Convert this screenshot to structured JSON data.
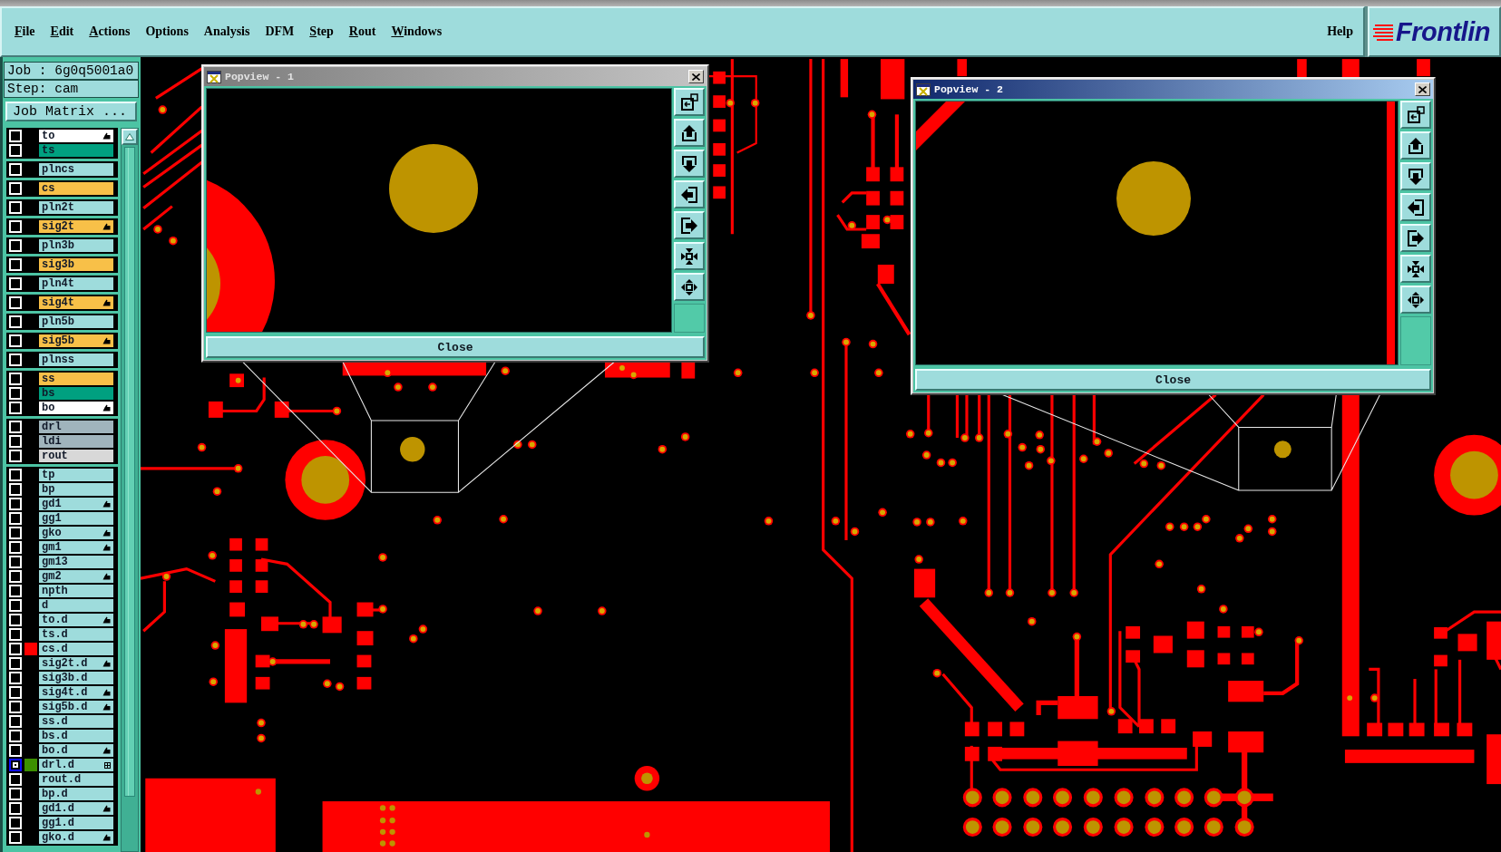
{
  "menu_bar": {
    "items": [
      {
        "label": "File",
        "mnemonic": true
      },
      {
        "label": "Edit",
        "mnemonic": true
      },
      {
        "label": "Actions",
        "mnemonic": true
      },
      {
        "label": "Options",
        "mnemonic": false
      },
      {
        "label": "Analysis",
        "mnemonic": false
      },
      {
        "label": "DFM",
        "mnemonic": false
      },
      {
        "label": "Step",
        "mnemonic": true
      },
      {
        "label": "Rout",
        "mnemonic": true
      },
      {
        "label": "Windows",
        "mnemonic": true
      }
    ],
    "help": "Help"
  },
  "logo": "Frontlin",
  "job_panel": {
    "job": "Job : 6g0q5001a0",
    "step": "Step: cam",
    "matrix_button": "Job Matrix ..."
  },
  "layer_groups": [
    {
      "layers": [
        {
          "name": "to",
          "color": "#ffffff",
          "kind": "pointer",
          "work_layer": false
        },
        {
          "name": "ts",
          "color": "#00a080",
          "kind": "plain",
          "work_layer": false
        }
      ]
    },
    {
      "layers": [
        {
          "name": "plncs",
          "color": "#9edcdc",
          "kind": "plain",
          "work_layer": false
        }
      ]
    },
    {
      "layers": [
        {
          "name": "cs",
          "color": "#f8c048",
          "kind": "plain",
          "work_layer": false
        }
      ]
    },
    {
      "layers": [
        {
          "name": "pln2t",
          "color": "#9edcdc",
          "kind": "plain",
          "work_layer": false
        }
      ]
    },
    {
      "layers": [
        {
          "name": "sig2t",
          "color": "#f8c048",
          "kind": "pointer",
          "work_layer": false
        }
      ]
    },
    {
      "layers": [
        {
          "name": "pln3b",
          "color": "#9edcdc",
          "kind": "plain",
          "work_layer": false
        }
      ]
    },
    {
      "layers": [
        {
          "name": "sig3b",
          "color": "#f8c048",
          "kind": "plain",
          "work_layer": false
        }
      ]
    },
    {
      "layers": [
        {
          "name": "pln4t",
          "color": "#9edcdc",
          "kind": "plain",
          "work_layer": false
        }
      ]
    },
    {
      "layers": [
        {
          "name": "sig4t",
          "color": "#f8c048",
          "kind": "pointer",
          "work_layer": false
        }
      ]
    },
    {
      "layers": [
        {
          "name": "pln5b",
          "color": "#9edcdc",
          "kind": "plain",
          "work_layer": false
        }
      ]
    },
    {
      "layers": [
        {
          "name": "sig5b",
          "color": "#f8c048",
          "kind": "pointer",
          "work_layer": false
        }
      ]
    },
    {
      "layers": [
        {
          "name": "plnss",
          "color": "#9edcdc",
          "kind": "plain",
          "work_layer": false
        }
      ]
    },
    {
      "layers": [
        {
          "name": "ss",
          "color": "#f8c048",
          "kind": "plain",
          "work_layer": false
        },
        {
          "name": "bs",
          "color": "#00a080",
          "kind": "plain",
          "work_layer": false
        },
        {
          "name": "bo",
          "color": "#ffffff",
          "kind": "pointer",
          "work_layer": false
        }
      ]
    },
    {
      "layers": [
        {
          "name": "drl",
          "color": "#a0b4bc",
          "kind": "plain",
          "work_layer": false
        },
        {
          "name": "ldi",
          "color": "#a0b4bc",
          "kind": "plain",
          "work_layer": false
        },
        {
          "name": "rout",
          "color": "#d8d8d8",
          "kind": "plain",
          "work_layer": false
        }
      ]
    },
    {
      "layers": [
        {
          "name": "tp",
          "color": "#9edcdc",
          "kind": "plain",
          "work_layer": false
        },
        {
          "name": "bp",
          "color": "#9edcdc",
          "kind": "plain",
          "work_layer": false
        },
        {
          "name": "gd1",
          "color": "#9edcdc",
          "kind": "pointer",
          "work_layer": false
        },
        {
          "name": "gg1",
          "color": "#9edcdc",
          "kind": "plain",
          "work_layer": false
        },
        {
          "name": "gko",
          "color": "#9edcdc",
          "kind": "pointer",
          "work_layer": false
        },
        {
          "name": "gm1",
          "color": "#9edcdc",
          "kind": "pointer",
          "work_layer": false
        },
        {
          "name": "gm13",
          "color": "#9edcdc",
          "kind": "plain",
          "work_layer": false
        },
        {
          "name": "gm2",
          "color": "#9edcdc",
          "kind": "pointer",
          "work_layer": false
        },
        {
          "name": "npth",
          "color": "#9edcdc",
          "kind": "plain",
          "work_layer": false
        },
        {
          "name": "d",
          "color": "#9edcdc",
          "kind": "plain",
          "work_layer": false
        },
        {
          "name": "to.d",
          "color": "#9edcdc",
          "kind": "pointer",
          "work_layer": false
        },
        {
          "name": "ts.d",
          "color": "#9edcdc",
          "kind": "plain",
          "work_layer": false
        },
        {
          "name": "cs.d",
          "color": "#9edcdc",
          "swatch": {
            "color": "#ff0000"
          },
          "kind": "plain",
          "work_layer": false
        },
        {
          "name": "sig2t.d",
          "color": "#9edcdc",
          "kind": "pointer",
          "work_layer": false
        },
        {
          "name": "sig3b.d",
          "color": "#9edcdc",
          "kind": "plain",
          "work_layer": false
        },
        {
          "name": "sig4t.d",
          "color": "#9edcdc",
          "kind": "pointer",
          "work_layer": false
        },
        {
          "name": "sig5b.d",
          "color": "#9edcdc",
          "kind": "pointer",
          "work_layer": false
        },
        {
          "name": "ss.d",
          "color": "#9edcdc",
          "kind": "plain",
          "work_layer": false
        },
        {
          "name": "bs.d",
          "color": "#9edcdc",
          "kind": "plain",
          "work_layer": false
        },
        {
          "name": "bo.d",
          "color": "#9edcdc",
          "kind": "pointer",
          "work_layer": false
        },
        {
          "name": "drl.d",
          "color": "#9edcdc",
          "swatch": {
            "color": "#3c9000"
          },
          "kind": "grid",
          "work_layer": true
        },
        {
          "name": "rout.d",
          "color": "#9edcdc",
          "kind": "plain",
          "work_layer": false
        },
        {
          "name": "bp.d",
          "color": "#9edcdc",
          "kind": "plain",
          "work_layer": false
        },
        {
          "name": "gd1.d",
          "color": "#9edcdc",
          "kind": "pointer",
          "work_layer": false
        },
        {
          "name": "gg1.d",
          "color": "#9edcdc",
          "kind": "plain",
          "work_layer": false
        },
        {
          "name": "gko.d",
          "color": "#9edcdc",
          "kind": "pointer",
          "work_layer": false
        }
      ]
    }
  ],
  "popviews": [
    {
      "title": "Popview - 1",
      "active": false,
      "close_button": "Close"
    },
    {
      "title": "Popview - 2",
      "active": true,
      "close_button": "Close"
    }
  ]
}
